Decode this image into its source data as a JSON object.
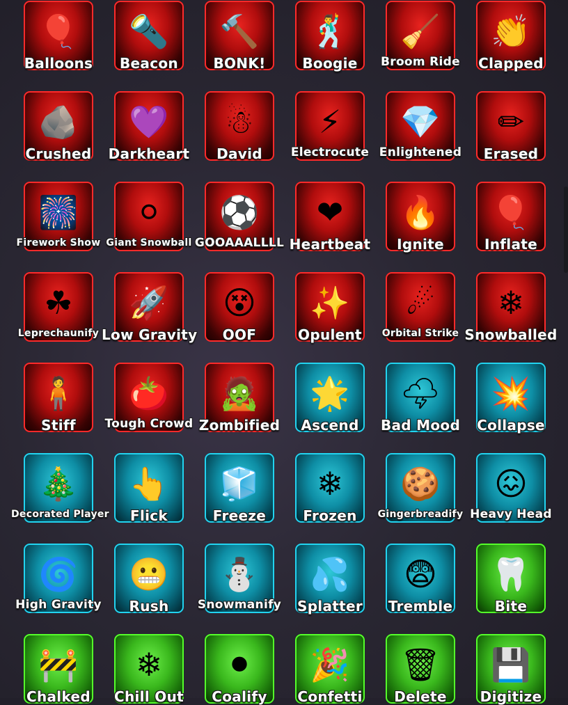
{
  "emotes": [
    {
      "label": "Balloons",
      "theme": "red",
      "icon": "balloons-icon",
      "glyph": "🎈",
      "size": "md"
    },
    {
      "label": "Beacon",
      "theme": "red",
      "icon": "beacon-icon",
      "glyph": "🔦",
      "size": "md"
    },
    {
      "label": "BONK!",
      "theme": "red",
      "icon": "bonk-icon",
      "glyph": "🔨",
      "size": "md"
    },
    {
      "label": "Boogie",
      "theme": "red",
      "icon": "boogie-icon",
      "glyph": "🕺",
      "size": "md"
    },
    {
      "label": "Broom Ride",
      "theme": "red",
      "icon": "broom-icon",
      "glyph": "🧹",
      "size": "sm"
    },
    {
      "label": "Clapped",
      "theme": "red",
      "icon": "clap-icon",
      "glyph": "👏",
      "size": "md"
    },
    {
      "label": "Crushed",
      "theme": "red",
      "icon": "crushed-icon",
      "glyph": "🪨",
      "size": "md"
    },
    {
      "label": "Darkheart",
      "theme": "red",
      "icon": "darkheart-icon",
      "glyph": "💜",
      "size": "md"
    },
    {
      "label": "David",
      "theme": "red",
      "icon": "snowman-icon",
      "glyph": "☃",
      "size": "md"
    },
    {
      "label": "Electrocute",
      "theme": "red",
      "icon": "electrocute-icon",
      "glyph": "⚡",
      "size": "sm"
    },
    {
      "label": "Enlightened",
      "theme": "red",
      "icon": "enlightened-icon",
      "glyph": "💎",
      "size": "sm"
    },
    {
      "label": "Erased",
      "theme": "red",
      "icon": "erased-icon",
      "glyph": "✏",
      "size": "md"
    },
    {
      "label": "Firework Show",
      "theme": "red",
      "icon": "firework-icon",
      "glyph": "🎆",
      "size": "xs"
    },
    {
      "label": "Giant Snowball",
      "theme": "red",
      "icon": "snowball-icon",
      "glyph": "⚪",
      "size": "xs"
    },
    {
      "label": "GOOAAALLLL",
      "theme": "red",
      "icon": "soccer-icon",
      "glyph": "⚽",
      "size": "sm"
    },
    {
      "label": "Heartbeat",
      "theme": "red",
      "icon": "heartbeat-icon",
      "glyph": "❤",
      "size": "md"
    },
    {
      "label": "Ignite",
      "theme": "red",
      "icon": "fire-icon",
      "glyph": "🔥",
      "size": "md"
    },
    {
      "label": "Inflate",
      "theme": "red",
      "icon": "inflate-icon",
      "glyph": "🎈",
      "size": "md"
    },
    {
      "label": "Leprechaunify",
      "theme": "red",
      "icon": "leprechaun-icon",
      "glyph": "☘",
      "size": "xs"
    },
    {
      "label": "Low Gravity",
      "theme": "red",
      "icon": "low-gravity-icon",
      "glyph": "🚀",
      "size": "md"
    },
    {
      "label": "OOF",
      "theme": "red",
      "icon": "oof-icon",
      "glyph": "😵",
      "size": "md"
    },
    {
      "label": "Opulent",
      "theme": "red",
      "icon": "opulent-icon",
      "glyph": "✨",
      "size": "md"
    },
    {
      "label": "Orbital Strike",
      "theme": "red",
      "icon": "orbital-strike-icon",
      "glyph": "☄",
      "size": "xs"
    },
    {
      "label": "Snowballed",
      "theme": "red",
      "icon": "snowballed-icon",
      "glyph": "❄",
      "size": "md"
    },
    {
      "label": "Stiff",
      "theme": "red",
      "icon": "stiff-icon",
      "glyph": "🧍",
      "size": "md"
    },
    {
      "label": "Tough Crowd",
      "theme": "red",
      "icon": "tomato-icon",
      "glyph": "🍅",
      "size": "sm"
    },
    {
      "label": "Zombified",
      "theme": "red",
      "icon": "zombie-icon",
      "glyph": "🧟",
      "size": "md"
    },
    {
      "label": "Ascend",
      "theme": "cyan",
      "icon": "ascend-icon",
      "glyph": "🌟",
      "size": "md"
    },
    {
      "label": "Bad Mood",
      "theme": "cyan",
      "icon": "storm-cloud-icon",
      "glyph": "🌩",
      "size": "md"
    },
    {
      "label": "Collapse",
      "theme": "cyan",
      "icon": "collapse-icon",
      "glyph": "💥",
      "size": "md"
    },
    {
      "label": "Decorated Player",
      "theme": "cyan",
      "icon": "christmas-tree-icon",
      "glyph": "🎄",
      "size": "xs"
    },
    {
      "label": "Flick",
      "theme": "cyan",
      "icon": "flick-icon",
      "glyph": "👆",
      "size": "md"
    },
    {
      "label": "Freeze",
      "theme": "cyan",
      "icon": "freeze-icon",
      "glyph": "🧊",
      "size": "md"
    },
    {
      "label": "Frozen",
      "theme": "cyan",
      "icon": "frozen-icon",
      "glyph": "❄",
      "size": "md"
    },
    {
      "label": "Gingerbreadify",
      "theme": "cyan",
      "icon": "gingerbread-icon",
      "glyph": "🍪",
      "size": "xs"
    },
    {
      "label": "Heavy Head",
      "theme": "cyan",
      "icon": "heavy-head-icon",
      "glyph": "😖",
      "size": "sm"
    },
    {
      "label": "High Gravity",
      "theme": "cyan",
      "icon": "high-gravity-icon",
      "glyph": "🌀",
      "size": "sm"
    },
    {
      "label": "Rush",
      "theme": "cyan",
      "icon": "rush-icon",
      "glyph": "😬",
      "size": "md"
    },
    {
      "label": "Snowmanify",
      "theme": "cyan",
      "icon": "snowman-icon",
      "glyph": "⛄",
      "size": "sm"
    },
    {
      "label": "Splatter",
      "theme": "cyan",
      "icon": "splatter-icon",
      "glyph": "💦",
      "size": "md"
    },
    {
      "label": "Tremble",
      "theme": "cyan",
      "icon": "tremble-icon",
      "glyph": "😨",
      "size": "md"
    },
    {
      "label": "Bite",
      "theme": "green",
      "icon": "bite-icon",
      "glyph": "🦷",
      "size": "md"
    },
    {
      "label": "Chalked",
      "theme": "green",
      "icon": "chalk-outline-icon",
      "glyph": "🚧",
      "size": "md"
    },
    {
      "label": "Chill Out",
      "theme": "green",
      "icon": "snowflake-icon",
      "glyph": "❄",
      "size": "md"
    },
    {
      "label": "Coalify",
      "theme": "green",
      "icon": "coal-icon",
      "glyph": "⚫",
      "size": "md"
    },
    {
      "label": "Confetti",
      "theme": "green",
      "icon": "confetti-icon",
      "glyph": "🎉",
      "size": "md"
    },
    {
      "label": "Delete",
      "theme": "green",
      "icon": "delete-menu-icon",
      "glyph": "🗑",
      "size": "md"
    },
    {
      "label": "Digitize",
      "theme": "green",
      "icon": "digitize-icon",
      "glyph": "💾",
      "size": "md"
    }
  ]
}
